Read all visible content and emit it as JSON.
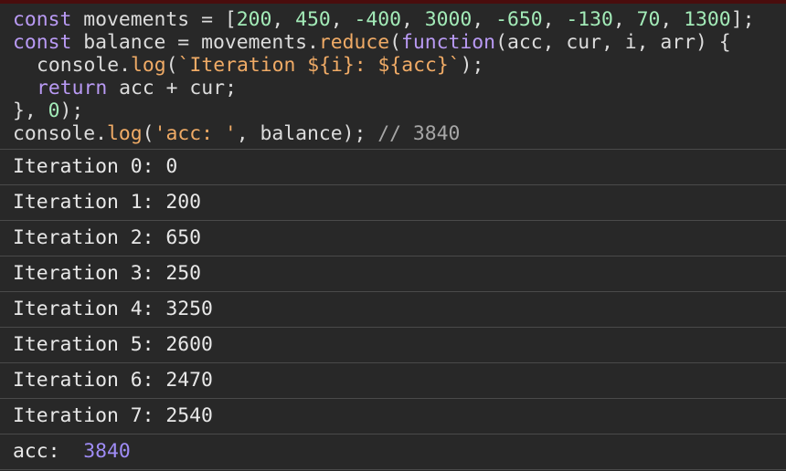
{
  "code": {
    "line1": {
      "kw": "const",
      "name": " movements = [",
      "nums": [
        "200",
        "450",
        "-400",
        "3000",
        "-650",
        "-130",
        "70",
        "1300"
      ],
      "sep": ", ",
      "end": "];"
    },
    "line2": {
      "kw": "const",
      "mid": " balance = movements.",
      "method": "reduce",
      "paren": "(",
      "fnkw": "function",
      "params": "(acc, cur, i, arr) {"
    },
    "line3": {
      "pre": "console.",
      "method": "log",
      "paren": "(",
      "tpl": "`Iteration ${i}: ${acc}`",
      "end": ");"
    },
    "line4": {
      "kw": "return",
      "rest": " acc + cur;"
    },
    "line5": {
      "pre": "}, ",
      "num": "0",
      "end": ");"
    },
    "line6": {
      "pre": "console.",
      "method": "log",
      "paren": "(",
      "str": "'acc: '",
      "mid": ", balance); ",
      "comment": "// 3840"
    }
  },
  "logs": [
    "Iteration 0: 0",
    "Iteration 1: 200",
    "Iteration 2: 650",
    "Iteration 3: 250",
    "Iteration 4: 3250",
    "Iteration 5: 2600",
    "Iteration 6: 2470",
    "Iteration 7: 2540"
  ],
  "result": {
    "label": "acc:  ",
    "value": "3840"
  }
}
